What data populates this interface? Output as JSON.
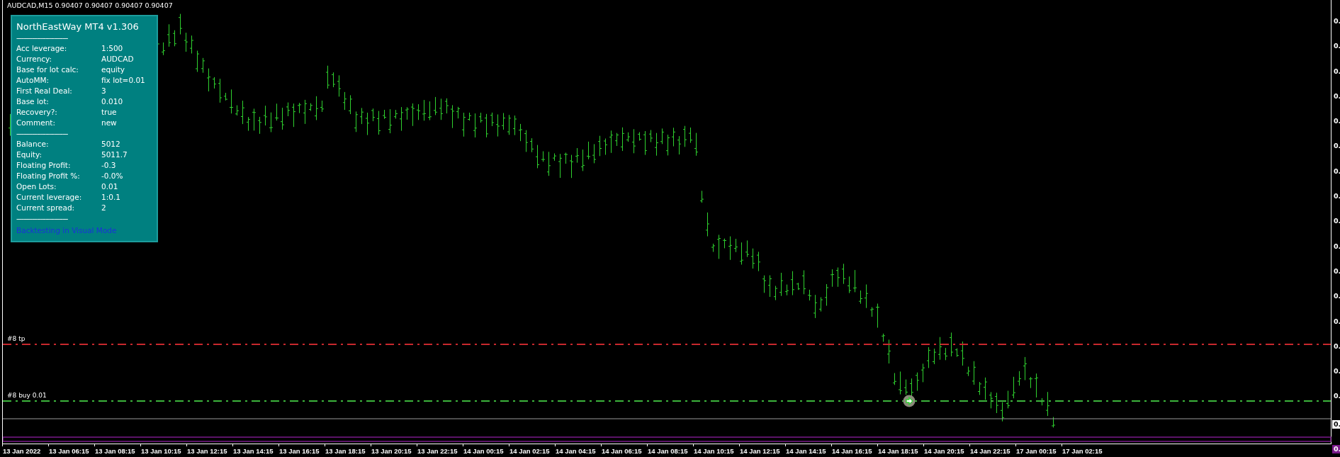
{
  "chart_header": "AUDCAD,M15  0.90407 0.90407 0.90407 0.90407",
  "panel": {
    "lines": [
      {
        "kind": "title",
        "text": "NorthEastWay MT4 v1.306"
      },
      {
        "kind": "separator",
        "text": "------------------------------"
      },
      {
        "kind": "row",
        "label": "Acc leverage:",
        "value": "1:500"
      },
      {
        "kind": "row",
        "label": "Currency:",
        "value": "AUDCAD"
      },
      {
        "kind": "row",
        "label": "Base for lot calc:",
        "value": "equity"
      },
      {
        "kind": "row",
        "label": "AutoMM:",
        "value": "fix lot=0.01"
      },
      {
        "kind": "row",
        "label": "First Real Deal:",
        "value": "3"
      },
      {
        "kind": "row",
        "label": "Base lot:",
        "value": "0.010"
      },
      {
        "kind": "row",
        "label": "Recovery?:",
        "value": "true"
      },
      {
        "kind": "row",
        "label": "Comment:",
        "value": "new"
      },
      {
        "kind": "separator",
        "text": "------------------------------"
      },
      {
        "kind": "row",
        "label": "Balance:",
        "value": "5012"
      },
      {
        "kind": "row",
        "label": "Equity:",
        "value": "5011.7"
      },
      {
        "kind": "row",
        "label": "Floating Profit:",
        "value": "-0.3"
      },
      {
        "kind": "row",
        "label": "Floating Profit %:",
        "value": "-0.0%"
      },
      {
        "kind": "row",
        "label": "Open Lots:",
        "value": "0.01"
      },
      {
        "kind": "row",
        "label": "Current leverage:",
        "value": "1:0.1"
      },
      {
        "kind": "row",
        "label": "Current spread:",
        "value": "2"
      },
      {
        "kind": "separator",
        "text": "------------------------------"
      },
      {
        "kind": "link",
        "text": "Backtesting in Visual Mode"
      }
    ]
  },
  "order_lines": [
    {
      "kind": "tp",
      "label": "#8 tp",
      "color": "#c8282d"
    },
    {
      "kind": "entry",
      "label": "#8 buy 0.01",
      "color": "#3cb43c"
    }
  ],
  "price_axis": {
    "labels": [
      "0.",
      "0.",
      "0.",
      "0.",
      "0.",
      "0.",
      "0.",
      "0.",
      "0.",
      "0.",
      "0.",
      "0.",
      "0.",
      "0.",
      "0.",
      "0."
    ],
    "bid_label": "0.",
    "marker_label": "0."
  },
  "time_axis": [
    "13 Jan 2022",
    "13 Jan 06:15",
    "13 Jan 08:15",
    "13 Jan 10:15",
    "13 Jan 12:15",
    "13 Jan 14:15",
    "13 Jan 16:15",
    "13 Jan 18:15",
    "13 Jan 20:15",
    "13 Jan 22:15",
    "14 Jan 00:15",
    "14 Jan 02:15",
    "14 Jan 04:15",
    "14 Jan 06:15",
    "14 Jan 08:15",
    "14 Jan 10:15",
    "14 Jan 12:15",
    "14 Jan 14:15",
    "14 Jan 16:15",
    "14 Jan 18:15",
    "14 Jan 20:15",
    "14 Jan 22:15",
    "17 Jan 00:15",
    "17 Jan 02:15"
  ]
}
